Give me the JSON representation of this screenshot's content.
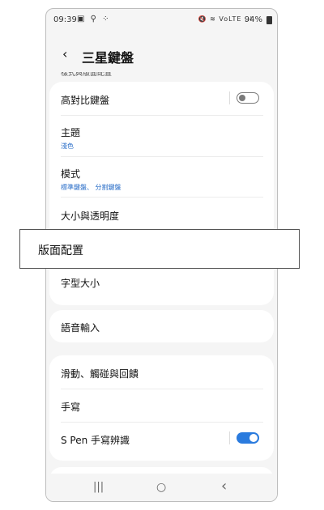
{
  "status_bar": {
    "time": "09:39",
    "left_icons": "▣ ⚲ ⁘",
    "right_icons": "🔇 ≋ VoLTE .ıl",
    "battery": "94%"
  },
  "header": {
    "back_icon": "‹",
    "title": "三星鍵盤"
  },
  "partial_text": "樣式與版面配置",
  "sections": {
    "contrast": {
      "label": "高對比鍵盤",
      "toggle": false
    },
    "theme": {
      "label": "主題",
      "sub": "淺色"
    },
    "mode": {
      "label": "模式",
      "sub": "標準鍵盤、 分割鍵盤"
    },
    "size": {
      "label": "大小與透明度"
    },
    "font_size": {
      "label": "字型大小"
    },
    "voice": {
      "label": "語音輸入"
    },
    "swipe": {
      "label": "滑動、觸碰與回饋"
    },
    "handwriting": {
      "label": "手寫"
    },
    "spen": {
      "label": "S Pen 手寫辨識",
      "toggle": true
    }
  },
  "popup": {
    "label": "版面配置"
  },
  "navbar": {
    "recent": "|||",
    "home": "○",
    "back": "‹"
  }
}
